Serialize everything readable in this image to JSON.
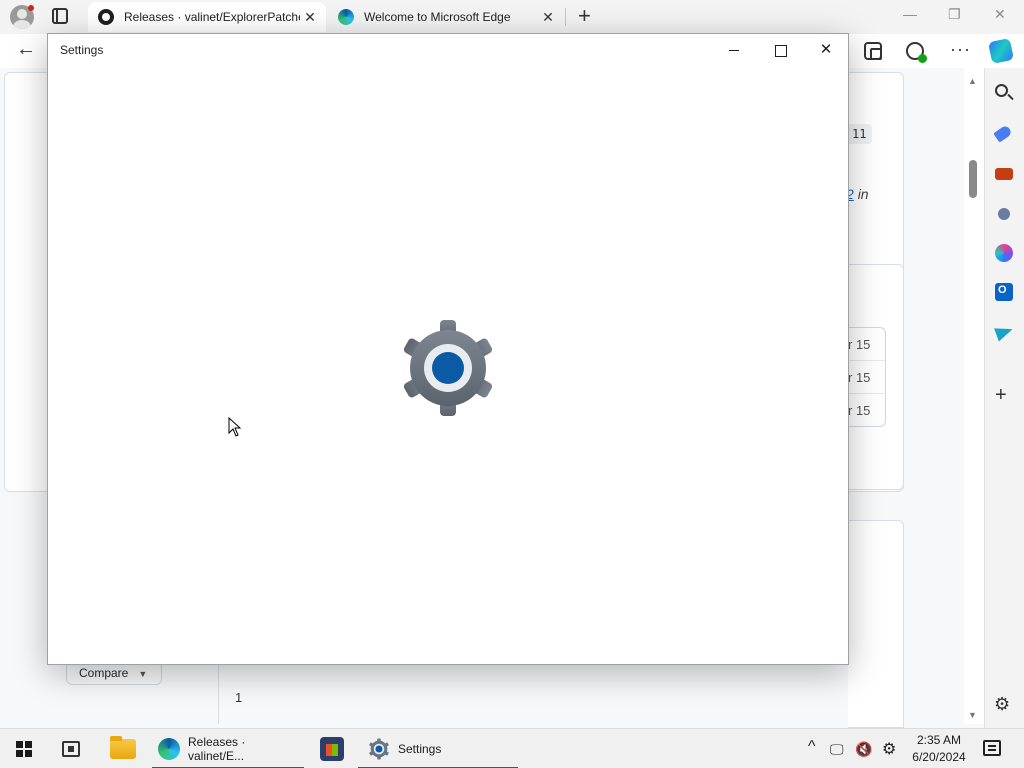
{
  "browser": {
    "tabs": [
      {
        "label": "Releases · valinet/ExplorerPatcher",
        "active": true,
        "favicon": "github-icon"
      },
      {
        "label": "Welcome to Microsoft Edge",
        "active": false,
        "favicon": "edge-icon"
      }
    ],
    "close_glyph": "✕",
    "new_tab_glyph": "+",
    "window_controls": {
      "minimize": "—",
      "restore": "❐",
      "close": "✕"
    },
    "toolbar": {
      "back_glyph": "←",
      "more_glyph": "···"
    },
    "sidebar": {
      "add_glyph": "+",
      "settings_glyph": "⚙"
    }
  },
  "webpage": {
    "tag_fragment": "11",
    "italic_fragment": {
      "link": "2",
      "text": "in"
    },
    "dates": [
      "r 15",
      "r 15",
      "r 15"
    ],
    "compare_label": "Compare",
    "compare_caret": "▼",
    "page_number": "1",
    "scroll_up_glyph": "▲",
    "scroll_down_glyph": "▼"
  },
  "settings_window": {
    "title": "Settings",
    "minimize_glyph": "",
    "maximize_glyph": "",
    "close_glyph": "✕",
    "splash_icon": "settings-gear-icon"
  },
  "taskbar": {
    "apps": [
      {
        "label": "Releases · valinet/E...",
        "icon": "edge-icon",
        "active": true
      },
      {
        "label": "Settings",
        "icon": "settings-gear-icon",
        "active": true
      }
    ],
    "tray": {
      "chevron": "^",
      "network": "🖵",
      "volume": "🔇",
      "settings": "⚙"
    },
    "clock": {
      "time": "2:35 AM",
      "date": "6/20/2024"
    }
  },
  "colors": {
    "accent": "#0067c0",
    "gear_blue": "#0c5aa6",
    "gear_grey": "#6b7480"
  }
}
